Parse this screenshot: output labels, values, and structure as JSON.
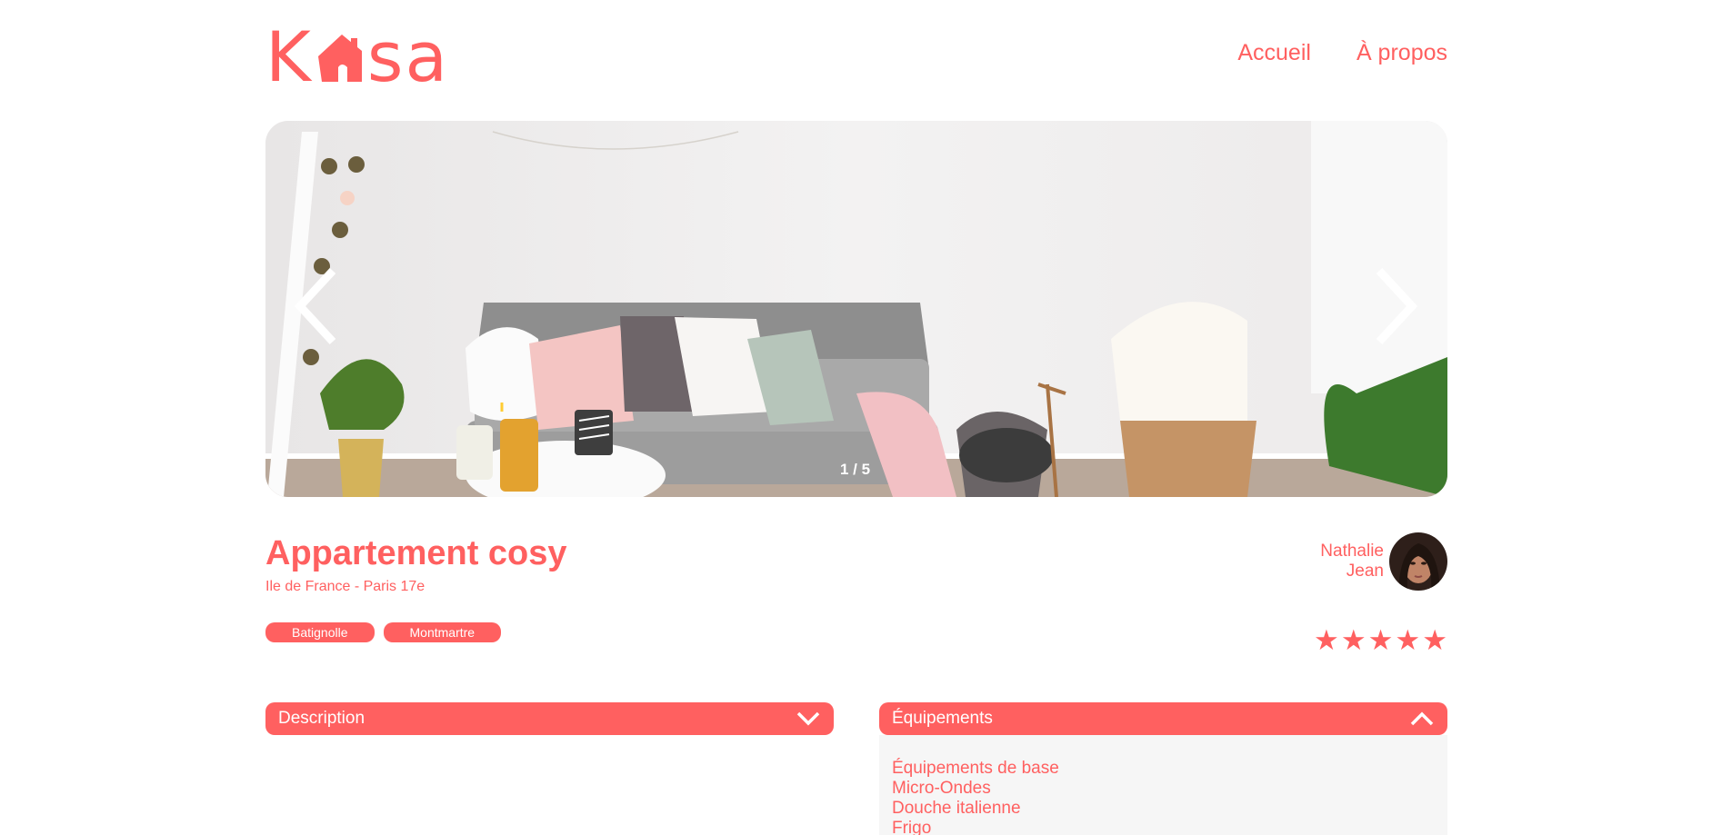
{
  "header": {
    "logo_part1": "K",
    "logo_part2": "sa",
    "nav": [
      "Accueil",
      "À propos"
    ]
  },
  "carousel": {
    "counter": "1 / 5",
    "current": 1,
    "total": 5
  },
  "listing": {
    "title": "Appartement cosy",
    "location": "Ile de France - Paris 17e",
    "tags": [
      "Batignolle",
      "Montmartre"
    ],
    "host": {
      "first_name": "Nathalie",
      "last_name": "Jean"
    },
    "rating": 5,
    "rating_max": 5,
    "star_glyph": "★"
  },
  "collapses": {
    "description": {
      "label": "Description",
      "state": "closed"
    },
    "equipments": {
      "label": "Équipements",
      "state": "open",
      "items": [
        "Équipements de base",
        "Micro-Ondes",
        "Douche italienne",
        "Frigo"
      ]
    }
  },
  "colors": {
    "accent": "#FF6060",
    "panel": "#F6F6F6"
  },
  "icons": [
    "house-logo-icon",
    "chevron-left-icon",
    "chevron-right-icon",
    "star-icon",
    "chevron-down-icon",
    "chevron-up-icon"
  ]
}
